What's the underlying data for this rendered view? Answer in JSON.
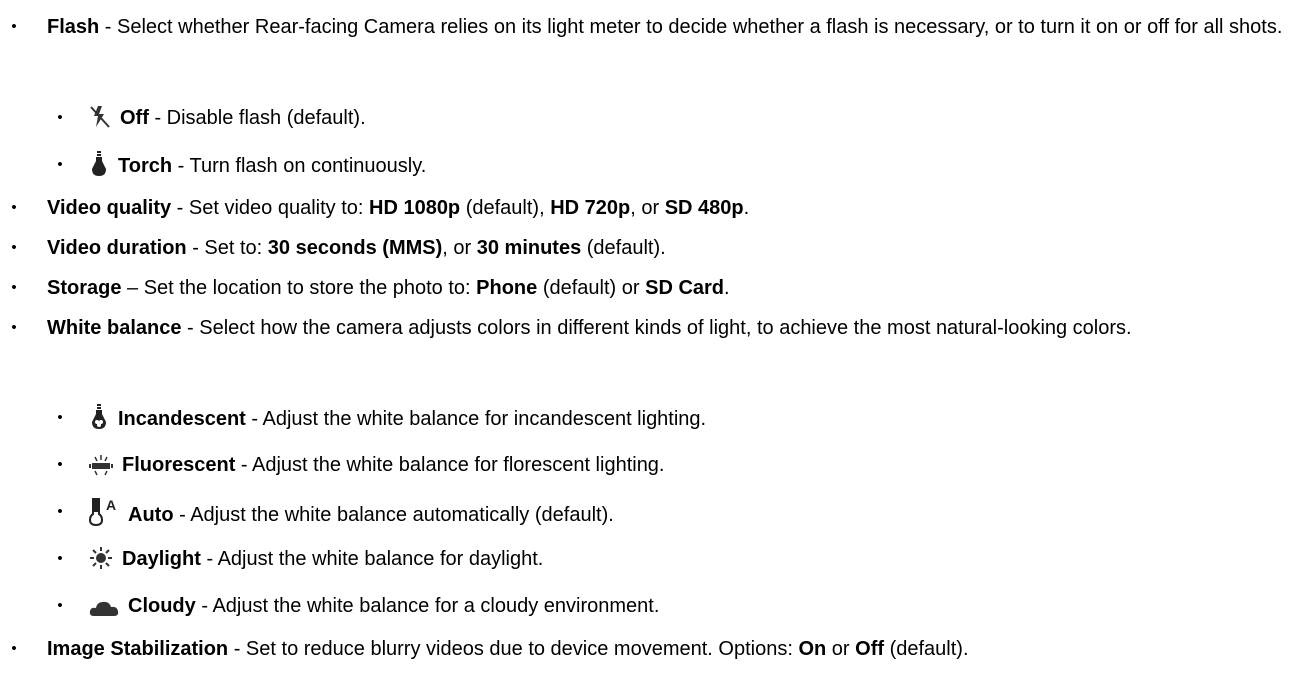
{
  "bullet_glyph": "•",
  "items": [
    {
      "label": "Flash",
      "desc": " - Select whether Rear-facing Camera relies on its light meter to decide whether a flash is necessary, or to turn it on or off for all shots.",
      "options": [
        {
          "icon": "flash-off-icon",
          "label": "Off",
          "desc": " - Disable flash (default)."
        },
        {
          "icon": "torch-icon",
          "label": "Torch",
          "desc": " - Turn flash on continuously."
        }
      ]
    },
    {
      "label": "Video quality",
      "desc_a": " - Set video quality to: ",
      "opt1": "HD 1080p",
      "desc_b": " (default), ",
      "opt2": "HD 720p",
      "desc_c": ", or ",
      "opt3": "SD 480p",
      "desc_d": "."
    },
    {
      "label": "Video duration",
      "desc_a": " - Set to: ",
      "opt1": "30 seconds (MMS)",
      "desc_b": ", or ",
      "opt2": "30 minutes",
      "desc_c": " (default)."
    },
    {
      "label": "Storage",
      "desc_a": " – Set the location to store the photo to: ",
      "opt1": "Phone",
      "desc_b": " (default) or ",
      "opt2": "SD Card",
      "desc_c": "."
    },
    {
      "label": "White balance",
      "desc": " - Select how the camera adjusts colors in different kinds of light, to achieve the most natural-looking colors.",
      "options": [
        {
          "icon": "incandescent-icon",
          "label": "Incandescent",
          "desc": " - Adjust the white balance for incandescent lighting."
        },
        {
          "icon": "fluorescent-icon",
          "label": "Fluorescent",
          "desc": " - Adjust the white balance for florescent lighting."
        },
        {
          "icon": "auto-white-balance-icon",
          "label": "Auto",
          "desc": " - Adjust the white balance automatically (default)."
        },
        {
          "icon": "daylight-icon",
          "label": "Daylight",
          "desc": " - Adjust the white balance for daylight."
        },
        {
          "icon": "cloudy-icon",
          "label": "Cloudy",
          "desc": " - Adjust the white balance for a cloudy environment."
        }
      ]
    },
    {
      "label": "Image Stabilization",
      "desc_a": " - Set to reduce blurry videos due to device movement. Options: ",
      "opt1": "On",
      "desc_b": " or ",
      "opt2": "Off",
      "desc_c": " (default)."
    }
  ]
}
